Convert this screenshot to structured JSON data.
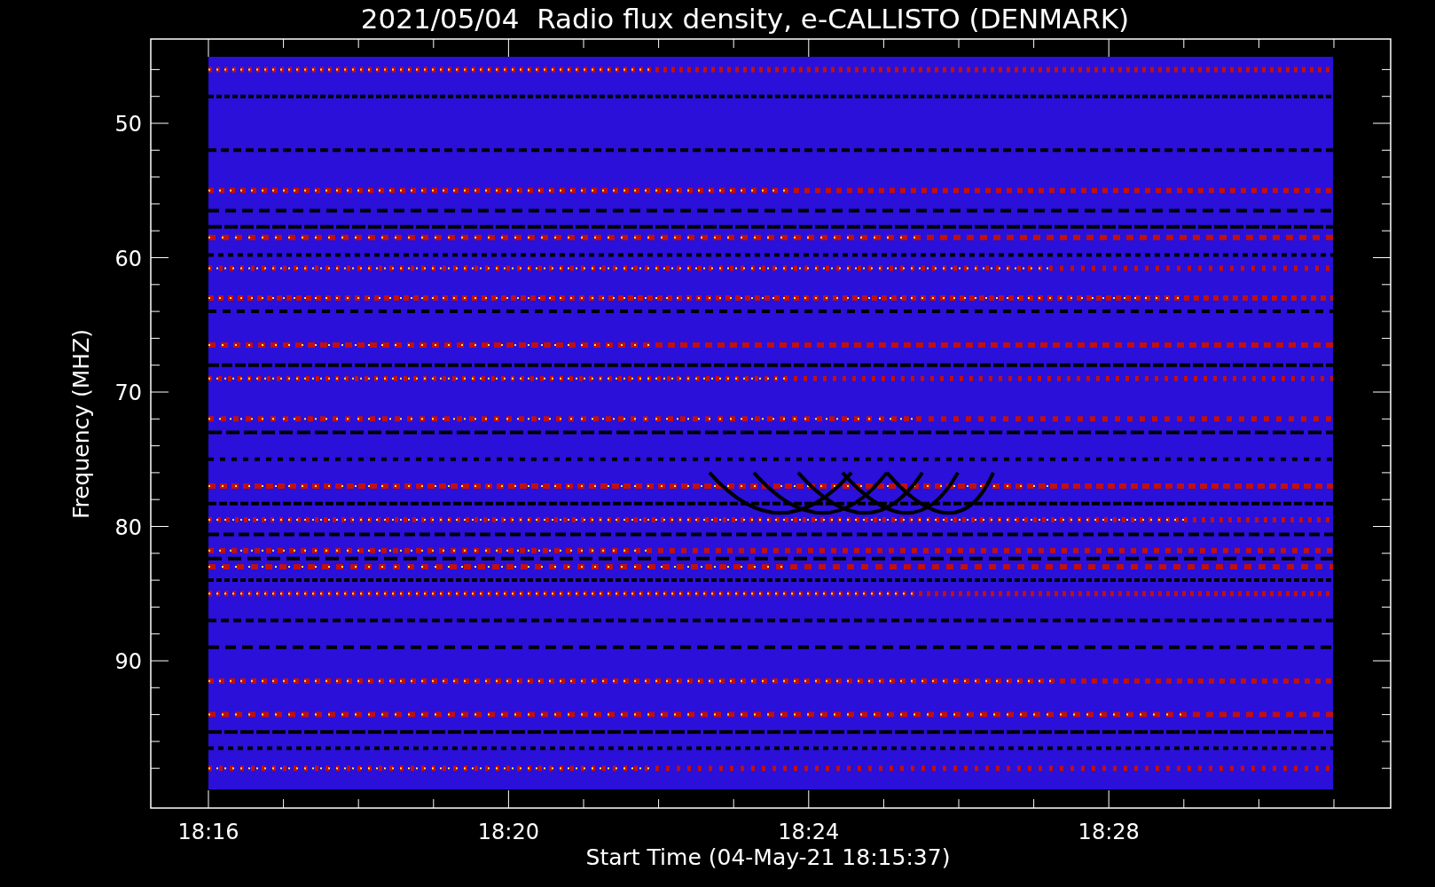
{
  "title": "2021/05/04  Radio flux density, e-CALLISTO (DENMARK)",
  "y_axis": {
    "label": "Frequency (MHZ)",
    "ticks": [
      "50",
      "60",
      "70",
      "80",
      "90"
    ]
  },
  "x_axis": {
    "label": "Start Time (04-May-21 18:15:37)",
    "ticks": [
      "18:16",
      "18:20",
      "18:24",
      "18:28"
    ]
  }
}
